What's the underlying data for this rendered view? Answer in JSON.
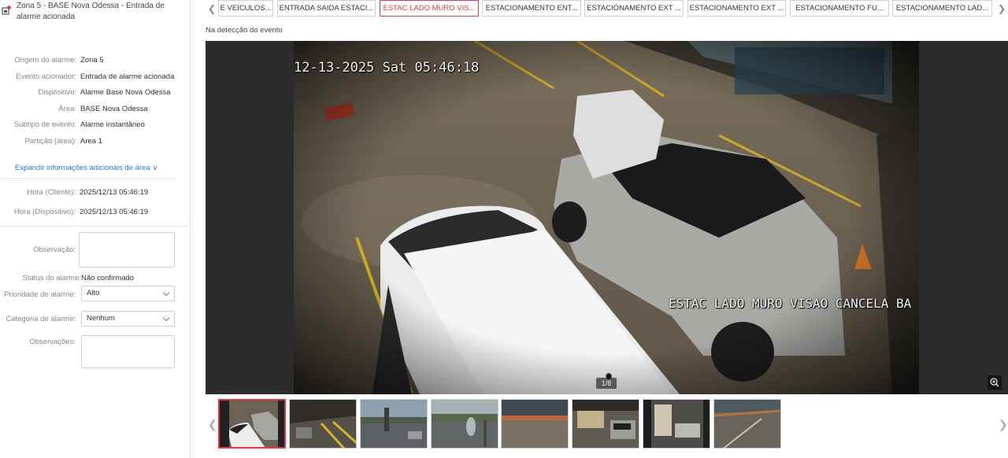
{
  "alarm": {
    "title": "Zona 5 - BASE Nova Odessa - Entrada de alarme acionada"
  },
  "details": [
    {
      "label": "Origem do alarme:",
      "value": "Zona 5"
    },
    {
      "label": "Evento acionador:",
      "value": "Entrada de alarme acionada"
    },
    {
      "label": "Dispositivo:",
      "value": "Alarme Base Nova Odessa"
    },
    {
      "label": "Área:",
      "value": "BASE Nova Odessa"
    },
    {
      "label": "Subtipo de evento:",
      "value": "Alarme instantâneo"
    },
    {
      "label": "Partição (área):",
      "value": "Area 1"
    }
  ],
  "expand_link": "Expandir informações adicionais de área",
  "times": [
    {
      "label": "Hora (Cliente):",
      "value": "2025/12/13 05:46:19"
    },
    {
      "label": "Hora (Dispositivo):",
      "value": "2025/12/13 05:46:19"
    }
  ],
  "form": {
    "observation_label": "Observação:",
    "status_label": "Status do alarme:",
    "status_value": "Não confirmado",
    "priority_label": "Prioridade de alarme:",
    "priority_value": "Alto",
    "category_label": "Categoria de alarme:",
    "category_value": "Nenhum",
    "notes_label": "Observações:"
  },
  "tabs": [
    {
      "label": "E VEICULOS...",
      "active": false
    },
    {
      "label": "ENTRADA SAIDA ESTACI...",
      "active": false
    },
    {
      "label": "ESTAC LADO MURO VIS...",
      "active": true
    },
    {
      "label": "ESTACIONAMENTO ENT...",
      "active": false
    },
    {
      "label": "ESTACIONAMENTO EXT ...",
      "active": false
    },
    {
      "label": "ESTACIONAMENTO EXT ...",
      "active": false
    },
    {
      "label": "ESTACIONAMENTO FU...",
      "active": false
    },
    {
      "label": "ESTACIONAMENTO LAD...",
      "active": false
    }
  ],
  "event_label": "Na detecção do evento",
  "camera": {
    "timestamp": "12-13-2025 Sat 05:46:18",
    "name": "ESTAC LADO MURO VISAO CANCELA BA"
  },
  "page_counter": "1/8",
  "colors": {
    "accent_red": "#d9393f",
    "link_blue": "#2a7ad8"
  }
}
